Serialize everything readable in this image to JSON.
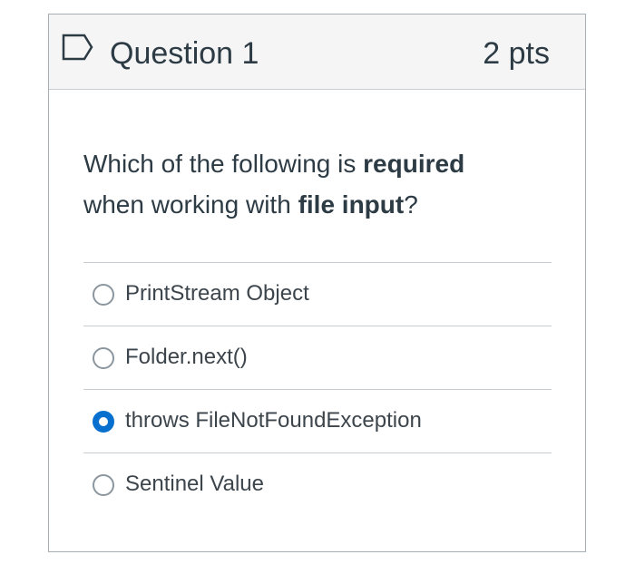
{
  "question": {
    "title": "Question 1",
    "points": "2 pts",
    "flag_icon": "flag-icon",
    "text_part1": "Which of the following is ",
    "text_bold1": "required",
    "text_part2": " when working with ",
    "text_bold2": "file input",
    "text_part3": "?"
  },
  "answers": [
    {
      "label": "PrintStream Object",
      "selected": false
    },
    {
      "label": "Folder.next()",
      "selected": false
    },
    {
      "label": "throws FileNotFoundException",
      "selected": true
    },
    {
      "label": "Sentinel Value",
      "selected": false
    }
  ],
  "colors": {
    "accent": "#0770cf",
    "header_bg": "#f5f5f5",
    "text": "#2d3b45",
    "border": "#c7cdd1"
  }
}
